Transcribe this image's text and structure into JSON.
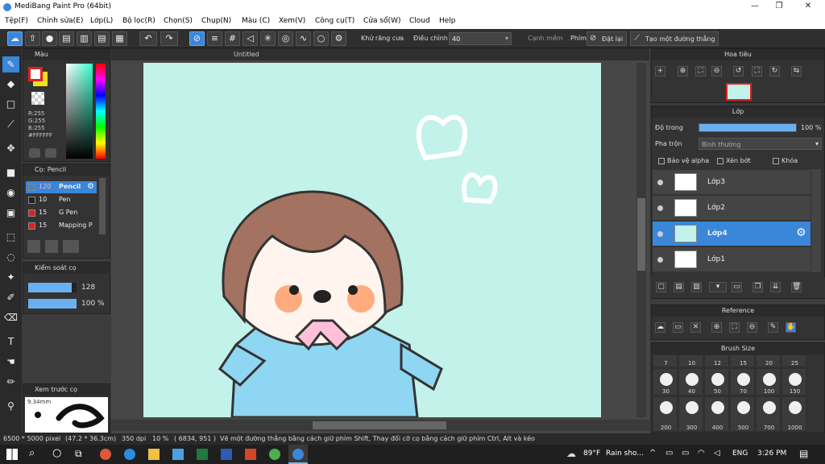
{
  "app": {
    "title": "MediBang Paint Pro (64bit)",
    "min": "—",
    "max": "❐",
    "close": "✕"
  },
  "menu": [
    "Tệp(F)",
    "Chỉnh sửa(E)",
    "Lớp(L)",
    "Bộ lọc(R)",
    "Chọn(S)",
    "Chụp(N)",
    "Màu (C)",
    "Xem(V)",
    "Công cụ(T)",
    "Cửa sổ(W)",
    "Cloud",
    "Help"
  ],
  "toolbar": {
    "antialias": "Khử răng cưa",
    "adjust_label": "Điều chỉnh",
    "adjust_value": "40",
    "soft_edge": "Cạnh mềm",
    "key_label": "Phím",
    "reset": "Đặt lại",
    "straight_line": "Tạo một đường thẳng"
  },
  "canvas": {
    "tab": "Untitled",
    "bg": "#c2f2ea"
  },
  "color_panel": {
    "title": "Màu",
    "r": "R:255",
    "g": "G:255",
    "b": "B:255",
    "hex": "#FFFFFF",
    "primary": "#e02020",
    "secondary": "#f0e020"
  },
  "brush_panel": {
    "title": "Cọ: Pencil",
    "items": [
      {
        "size": "120",
        "name": "Pencil",
        "color": "#3a86d8",
        "selected": true
      },
      {
        "size": "10",
        "name": "Pen",
        "color": "#222222",
        "selected": false
      },
      {
        "size": "15",
        "name": "G Pen",
        "color": "#e02020",
        "selected": false
      },
      {
        "size": "15",
        "name": "Mapping P",
        "color": "#e02020",
        "selected": false
      }
    ]
  },
  "brush_control": {
    "title": "Kiểm soát cọ",
    "size": "128",
    "opacity": "100 %",
    "size_fill": 0.9,
    "opacity_fill": 1.0
  },
  "preview": {
    "title": "Xem trước cọ",
    "size": "9.34mm"
  },
  "navigator": {
    "title": "Hoa tiêu"
  },
  "layers": {
    "title": "Lớp",
    "opacity_label": "Độ trong",
    "opacity_value": "100 %",
    "blend_label": "Pha trộn",
    "blend_value": "Bình thường",
    "protect_alpha": "Bảo vệ alpha",
    "clipping": "Xén bớt",
    "lock": "Khóa",
    "items": [
      {
        "name": "Lớp3",
        "selected": false
      },
      {
        "name": "Lớp2",
        "selected": false
      },
      {
        "name": "Lớp4",
        "selected": true
      },
      {
        "name": "Lớp1",
        "selected": false
      }
    ]
  },
  "reference": {
    "title": "Reference"
  },
  "brush_size": {
    "title": "Brush Size",
    "row1": [
      "7",
      "10",
      "12",
      "15",
      "20",
      "25"
    ],
    "row2": [
      "30",
      "40",
      "50",
      "70",
      "100",
      "150"
    ],
    "row3": [
      "200",
      "300",
      "400",
      "500",
      "700",
      "1000"
    ]
  },
  "status": {
    "dims": "6500 * 5000 pixel",
    "cm": "(47.2 * 36.3cm)",
    "dpi": "350 dpi",
    "zoom": "10 %",
    "coords": "( 6834, 951 )",
    "hint": "Vẽ một đường thẳng bằng cách giữ phím Shift, Thay đổi cỡ cọ bằng cách giữ phím Ctrl, Alt và kéo"
  },
  "taskbar": {
    "weather_temp": "89°F",
    "weather_text": "Rain sho...",
    "lang": "ENG",
    "time": "3:26 PM"
  },
  "colors": {
    "accent": "#3a86d8"
  }
}
